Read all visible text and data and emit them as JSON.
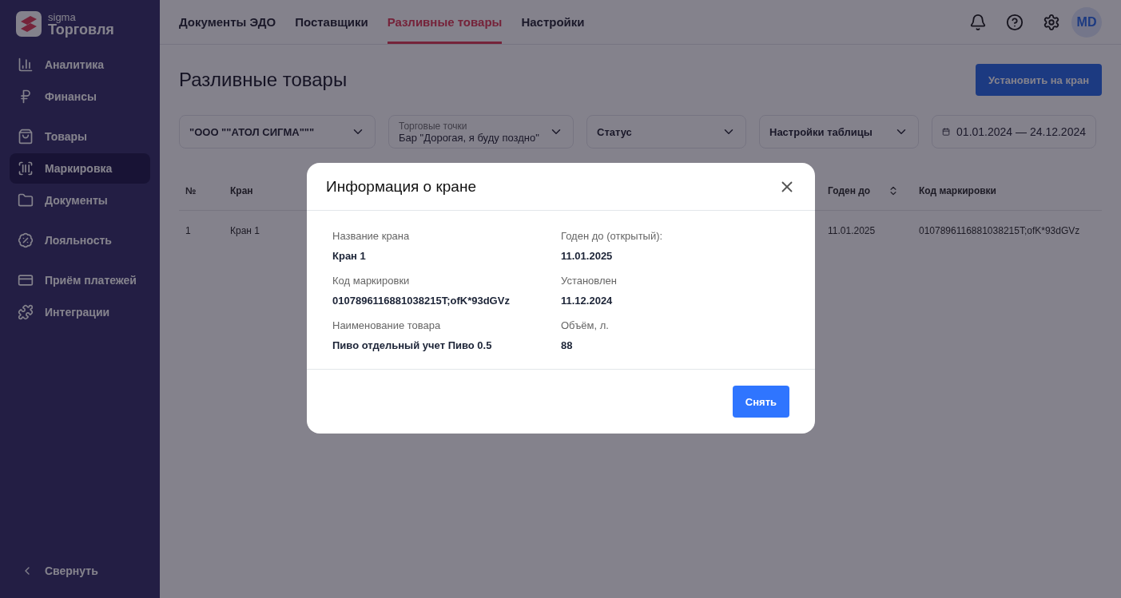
{
  "brand": {
    "small": "sigma",
    "name": "Торговля"
  },
  "sidebar": {
    "groups": [
      {
        "items": [
          {
            "kind": "analytics",
            "label": "Аналитика",
            "selected": false
          },
          {
            "kind": "finance",
            "label": "Финансы",
            "selected": false
          }
        ]
      },
      {
        "items": [
          {
            "kind": "goods",
            "label": "Товары",
            "selected": false
          },
          {
            "kind": "marking",
            "label": "Маркировка",
            "selected": true
          },
          {
            "kind": "documents",
            "label": "Документы",
            "selected": false
          }
        ]
      },
      {
        "items": [
          {
            "kind": "loyalty",
            "label": "Лояльность",
            "selected": false
          }
        ]
      },
      {
        "items": [
          {
            "kind": "payments",
            "label": "Приём платежей",
            "selected": false
          },
          {
            "kind": "integrations",
            "label": "Интеграции",
            "selected": false
          }
        ]
      }
    ],
    "collapse": "Свернуть"
  },
  "tabs": [
    {
      "label": "Документы ЭДО",
      "selected": false
    },
    {
      "label": "Поставщики",
      "selected": false
    },
    {
      "label": "Разливные товары",
      "selected": true
    },
    {
      "label": "Настройки",
      "selected": false
    }
  ],
  "avatar": "MD",
  "page_title": "Разливные товары",
  "primary_button": "Установить на кран",
  "filters": [
    {
      "kind": "select",
      "value": "\"ООО \"\"АТОЛ СИГМА\"\"\""
    },
    {
      "kind": "select",
      "label": "Торговые точки",
      "value": "Бар \"Дорогая, я буду поздно\""
    },
    {
      "kind": "select",
      "value": "Статус"
    },
    {
      "kind": "select",
      "value": "Настройки таблицы"
    },
    {
      "kind": "date",
      "value": "01.01.2024 — 24.12.2024"
    }
  ],
  "table": {
    "columns": [
      {
        "label": "№",
        "sortable": false
      },
      {
        "label": "Кран",
        "sortable": false
      },
      {
        "label": "Годен до",
        "sortable": true
      },
      {
        "label": "Код маркировки",
        "sortable": false
      }
    ],
    "rows": [
      [
        "1",
        "Кран 1",
        "11.01.2025",
        "0107896116881038215T;ofK*93dGVz"
      ]
    ]
  },
  "modal": {
    "title": "Информация о кране",
    "fields": [
      {
        "label": "Название крана",
        "value": "Кран 1"
      },
      {
        "label": "Годен до (открытый):",
        "value": "11.01.2025"
      },
      {
        "label": "Код маркировки",
        "value": "0107896116881038215T;ofK*93dGVz"
      },
      {
        "label": "Установлен",
        "value": "11.12.2024"
      },
      {
        "label": "Наименование товара",
        "value": "Пиво отдельный учет Пиво 0.5"
      },
      {
        "label": "Объём, л.",
        "value": "88"
      }
    ],
    "button": "Снять"
  }
}
